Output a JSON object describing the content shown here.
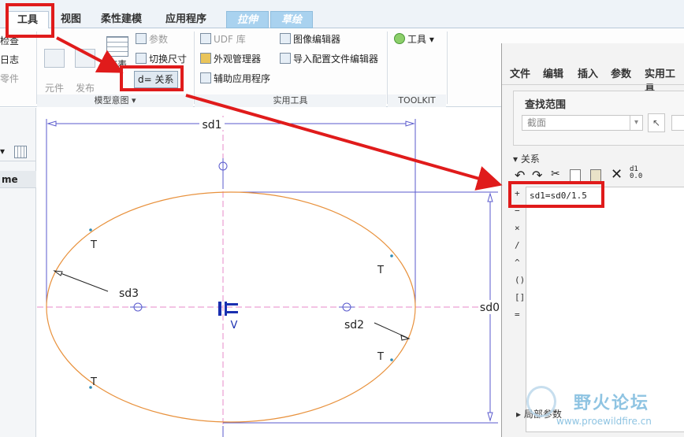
{
  "tabs": {
    "tools": "工具",
    "view": "视图",
    "flexible": "柔性建模",
    "apps": "应用程序",
    "extrude": "拉伸",
    "sketch": "草绘"
  },
  "ribbon": {
    "left_cut": {
      "check": "检查",
      "log": "日志",
      "parts": "零件"
    },
    "model_intent": {
      "component_interface": "元件\n界面",
      "publish_geometry": "发布\n几何",
      "table": "族表",
      "params": "参数",
      "switch_dims": "切换尺寸",
      "relations": "d= 关系",
      "group_label": "模型意图"
    },
    "utilities": {
      "udf": "UDF 库",
      "appearance": "外观管理器",
      "aux_apps": "辅助应用程序",
      "image_editor": "图像编辑器",
      "import_config": "导入配置文件编辑器",
      "group_label": "实用工具"
    },
    "toolkit": {
      "tools": "工具",
      "group_label": "TOOLKIT"
    }
  },
  "left_panel": {
    "col_header": "me"
  },
  "sketch": {
    "dims": {
      "sd0": "sd0",
      "sd1": "sd1",
      "sd2": "sd2",
      "sd3": "sd3"
    },
    "tangent_label": "T",
    "vertical_label": "V",
    "colors": {
      "ellipse": "#e8913c",
      "construction": "#e78ac8",
      "dimension": "#5a5acd",
      "constraint": "#1a2fb0"
    }
  },
  "relations_panel": {
    "menu": [
      "文件",
      "编辑",
      "插入",
      "参数",
      "实用工具"
    ],
    "lookup_label": "查找范围",
    "lookup_value": "截面",
    "section_label": "关系",
    "relation_text": "sd1=sd0/1.5",
    "operators": [
      "+",
      "−",
      "×",
      "/",
      "^",
      "()",
      "[]",
      "="
    ],
    "local_params": "局部参数"
  },
  "watermark": {
    "name": "野火论坛",
    "url": "www.proewildfire.cn"
  }
}
